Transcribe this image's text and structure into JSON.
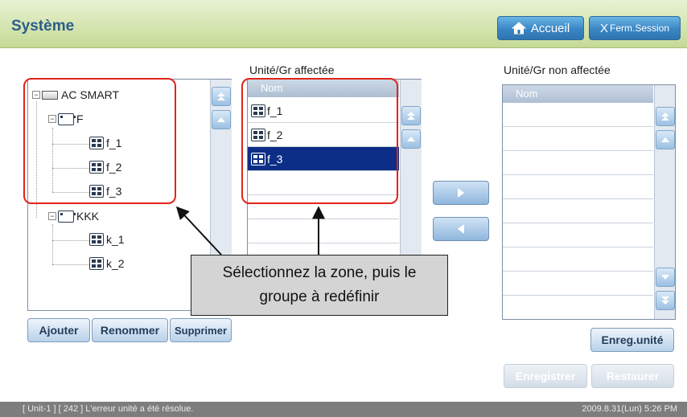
{
  "header": {
    "title": "Système",
    "home_label": "Accueil",
    "logout_label": "Ferm.Session",
    "logout_prefix": "X"
  },
  "tree": {
    "root": "AC SMART",
    "groups": [
      {
        "name": "F",
        "units": [
          "f_1",
          "f_2",
          "f_3"
        ]
      },
      {
        "name": "KKK",
        "units": [
          "k_1",
          "k_2"
        ]
      }
    ],
    "expander_symbol": "−"
  },
  "assigned": {
    "label": "Unité/Gr affectée",
    "column_header": "Nom",
    "rows": [
      "f_1",
      "f_2",
      "f_3"
    ],
    "selected_row": "f_3"
  },
  "unassigned": {
    "label": "Unité/Gr non affectée",
    "column_header": "Nom",
    "rows": []
  },
  "buttons": {
    "add": "Ajouter",
    "rename": "Renommer",
    "delete": "Supprimer",
    "save_unit": "Enreg.unité",
    "save": "Enregistrer",
    "restore": "Restaurer"
  },
  "callout": {
    "line1": "Sélectionnez la zone, puis le",
    "line2": "groupe à redéfinir"
  },
  "status": {
    "message": "[ Unit-1 ] [ 242 ] L'erreur unité a été résolue.",
    "datetime": "2009.8.31(Lun)  5:26 PM"
  },
  "colors": {
    "header_bg": "#d3e4ad",
    "title": "#2c5e8c",
    "selection": "#0c2e86",
    "highlight": "#e2231a",
    "status_bg": "#7d7d7d"
  }
}
